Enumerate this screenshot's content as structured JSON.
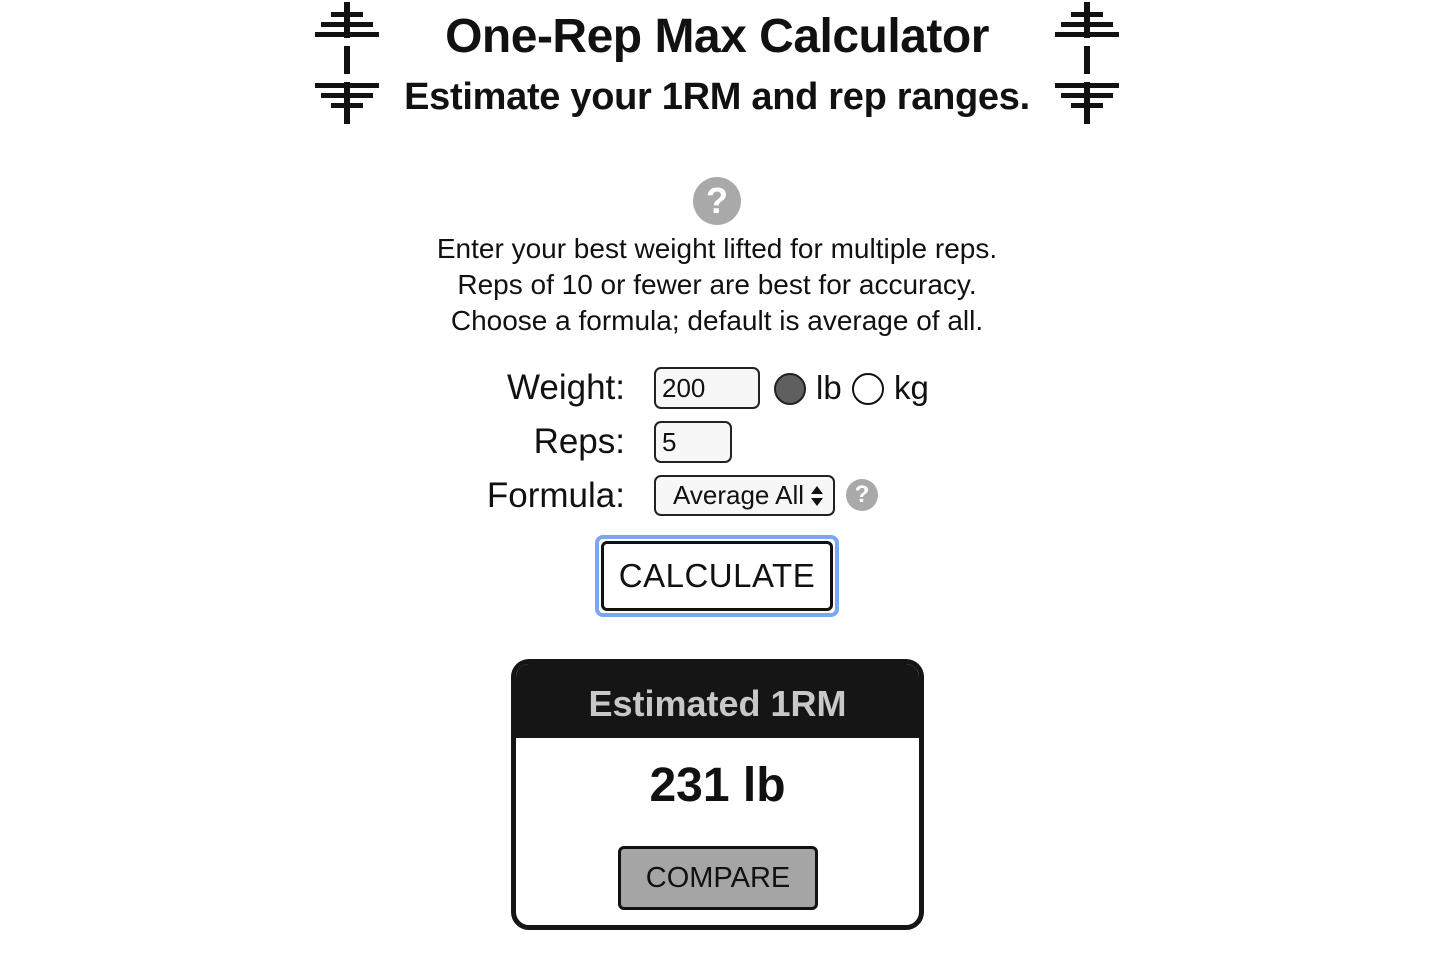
{
  "header": {
    "title": "One-Rep Max Calculator",
    "subtitle": "Estimate your 1RM and rep ranges.",
    "left_icon": "barbell-icon",
    "right_icon": "barbell-icon"
  },
  "help": {
    "icon": "question-circle-icon",
    "symbol": "?"
  },
  "instructions": {
    "line1": "Enter your best weight lifted for multiple reps.",
    "line2": "Reps of 10 or fewer are best for accuracy.",
    "line3": "Choose a formula; default is average of all."
  },
  "form": {
    "weight": {
      "label": "Weight:",
      "value": "200"
    },
    "units": {
      "options": [
        {
          "label": "lb",
          "checked": true
        },
        {
          "label": "kg",
          "checked": false
        }
      ]
    },
    "reps": {
      "label": "Reps:",
      "value": "5"
    },
    "formula": {
      "label": "Formula:",
      "selected": "Average All",
      "help_symbol": "?"
    },
    "calculate_label": "CALCULATE"
  },
  "result": {
    "header": "Estimated 1RM",
    "value": "231 lb",
    "compare_label": "COMPARE"
  },
  "colors": {
    "help_icon": "#a9a9a9",
    "focus_ring": "#7aa7f0",
    "result_header_bg": "#151515",
    "result_header_text": "#c8c8c8",
    "compare_bg": "#a5a5a5",
    "radio_checked": "#5f5f5f"
  }
}
